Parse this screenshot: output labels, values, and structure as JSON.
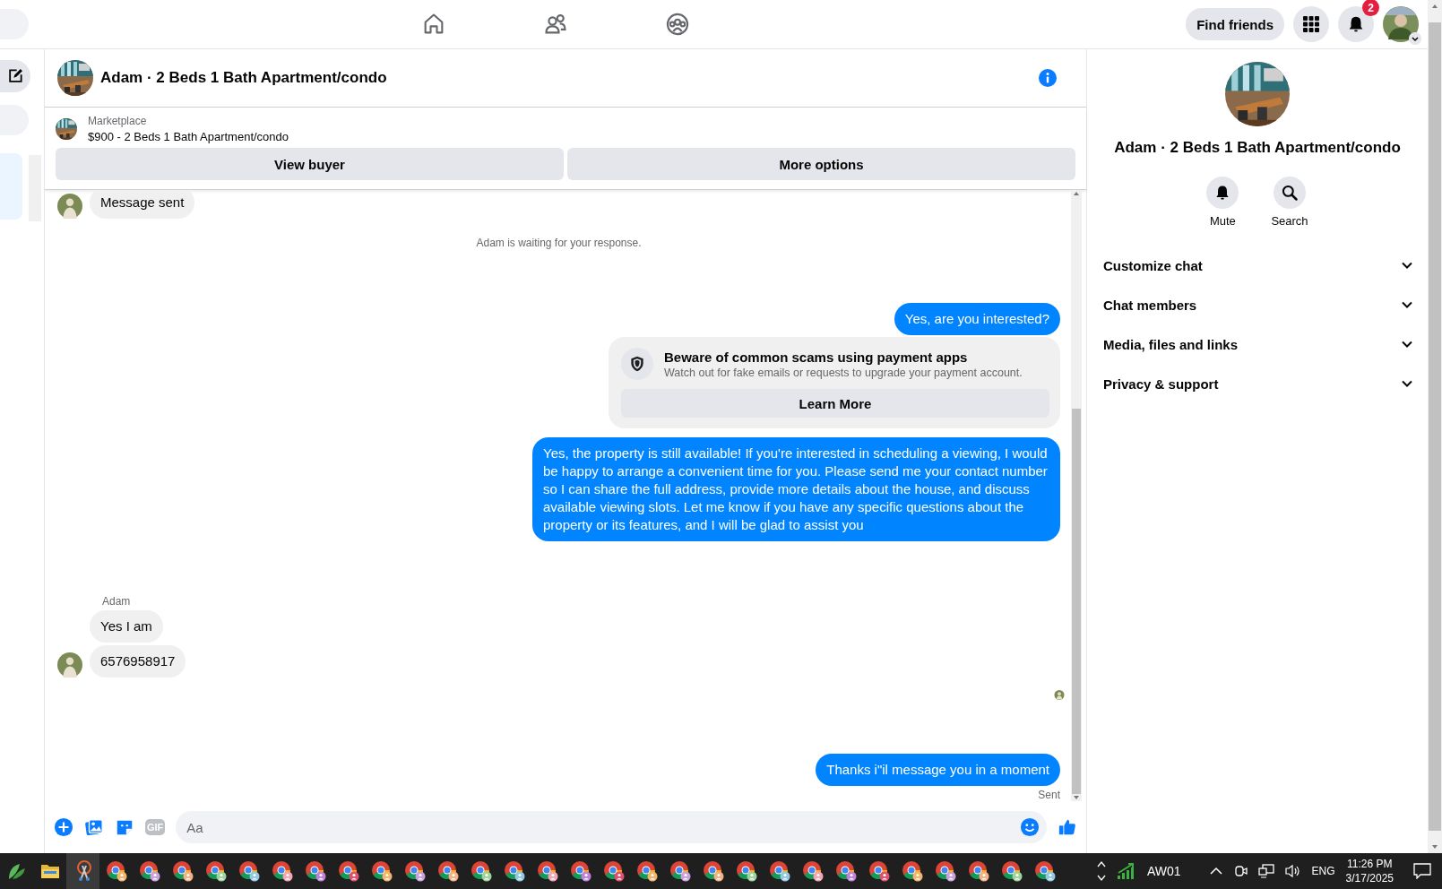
{
  "top_bar": {
    "find_friends": "Find friends",
    "notification_count": "2"
  },
  "chat": {
    "title": "Adam · 2 Beds 1 Bath Apartment/condo",
    "listing": {
      "label": "Marketplace",
      "text": "$900 - 2 Beds 1 Bath Apartment/condo"
    },
    "buttons": [
      "View buyer",
      "More options"
    ],
    "messages": [
      {
        "kind": "incoming",
        "text": "Message sent",
        "avatar": true
      },
      {
        "kind": "notice",
        "text": "Adam is waiting for your response."
      },
      {
        "kind": "outgoing",
        "text": "Yes, are you interested?"
      },
      {
        "kind": "card",
        "title": "Beware of common scams using payment apps",
        "subtitle": "Watch out for fake emails or requests to upgrade your payment account.",
        "button": "Learn More"
      },
      {
        "kind": "outgoing",
        "text": "Yes, the property is still available! If you're interested in scheduling a viewing, I would be happy to arrange a convenient time for you. Please send me your contact number so I can share the full address, provide more details about the house, and discuss available viewing slots. Let me know if you have any specific questions about the property or its features, and I will be glad to assist you"
      },
      {
        "kind": "sender",
        "text": "Adam"
      },
      {
        "kind": "incoming",
        "text": "Yes I am",
        "avatar": false
      },
      {
        "kind": "incoming",
        "text": "6576958917",
        "avatar": true
      },
      {
        "kind": "seen"
      },
      {
        "kind": "outgoing",
        "text": "Thanks i\"il message you in a moment"
      },
      {
        "kind": "status",
        "text": "Sent"
      }
    ],
    "composer": {
      "gif": "GIF",
      "placeholder": "Aa"
    }
  },
  "details": {
    "title": "Adam · 2 Beds 1 Bath Apartment/condo",
    "actions": [
      {
        "kind": "mute",
        "label": "Mute"
      },
      {
        "kind": "search",
        "label": "Search"
      }
    ],
    "sections": [
      {
        "label": "Customize chat",
        "expanded": false
      },
      {
        "label": "Chat members",
        "expanded": false
      },
      {
        "label": "Media, files and links",
        "expanded": false
      },
      {
        "label": "Privacy & support",
        "expanded": false
      }
    ]
  },
  "taskbar": {
    "network": "AW01",
    "language": "ENG",
    "time": "11:26 PM",
    "date": "3/17/2025"
  }
}
